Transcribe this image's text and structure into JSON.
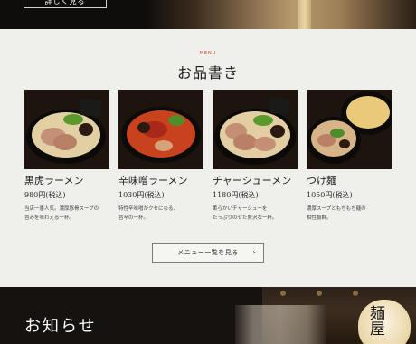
{
  "hero": {
    "button_label": "詳しく見る"
  },
  "menu": {
    "kicker": "MENU",
    "title": "お品書き",
    "items": [
      {
        "name": "黒虎ラーメン",
        "price": "980円(税込)",
        "desc": [
          "当店一番人気。濃厚豚骨スープの",
          "旨みを味わえる一杯。"
        ]
      },
      {
        "name": "辛味噌ラーメン",
        "price": "1030円(税込)",
        "desc": [
          "特性辛味噌がクセになる、",
          "旨辛の一杯。"
        ]
      },
      {
        "name": "チャーシューメン",
        "price": "1180円(税込)",
        "desc": [
          "柔らかいチャーシューを",
          "たっぷりのせた贅沢な一杯。"
        ]
      },
      {
        "name": "つけ麺",
        "price": "1050円(税込)",
        "desc": [
          "濃厚スープともちもち麺の",
          "相性抜群。"
        ]
      }
    ],
    "more_button": "メニュー一覧を見る",
    "more_arrow": "›"
  },
  "news": {
    "heading": "お知らせ",
    "lantern_text": "麺屋"
  },
  "colors": {
    "accent": "#b8432f",
    "dark": "#151210",
    "bg": "#efefec"
  }
}
